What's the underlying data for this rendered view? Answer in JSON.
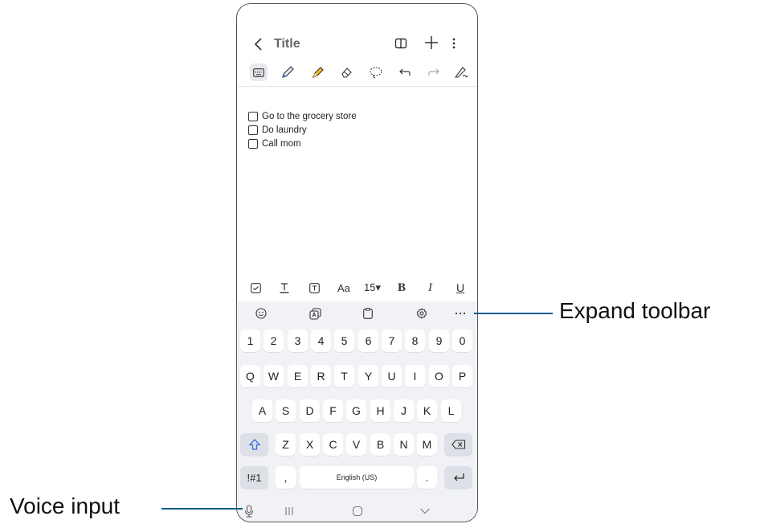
{
  "app": {
    "title": "Title"
  },
  "note": {
    "items": [
      "Go to the grocery store",
      "Do laundry",
      "Call mom"
    ]
  },
  "format_bar": {
    "aa_label": "Aa",
    "size_label": "15▾",
    "bold_label": "B",
    "italic_label": "I",
    "underline_label": "U"
  },
  "keyboard": {
    "row_numbers": [
      "1",
      "2",
      "3",
      "4",
      "5",
      "6",
      "7",
      "8",
      "9",
      "0"
    ],
    "row_q": [
      "Q",
      "W",
      "E",
      "R",
      "T",
      "Y",
      "U",
      "I",
      "O",
      "P"
    ],
    "row_a": [
      "A",
      "S",
      "D",
      "F",
      "G",
      "H",
      "J",
      "K",
      "L"
    ],
    "row_z": [
      "Z",
      "X",
      "C",
      "V",
      "B",
      "N",
      "M"
    ],
    "symbols_label": "!#1",
    "comma_label": ",",
    "space_label": "English (US)",
    "period_label": "."
  },
  "callouts": {
    "expand_toolbar": "Expand toolbar",
    "voice_input": "Voice input"
  },
  "colors": {
    "callout_line": "#0b5c8c",
    "pen": "#4a6fd6",
    "highlighter": "#f0c020",
    "keyboard_bg": "#f1f2f5"
  }
}
